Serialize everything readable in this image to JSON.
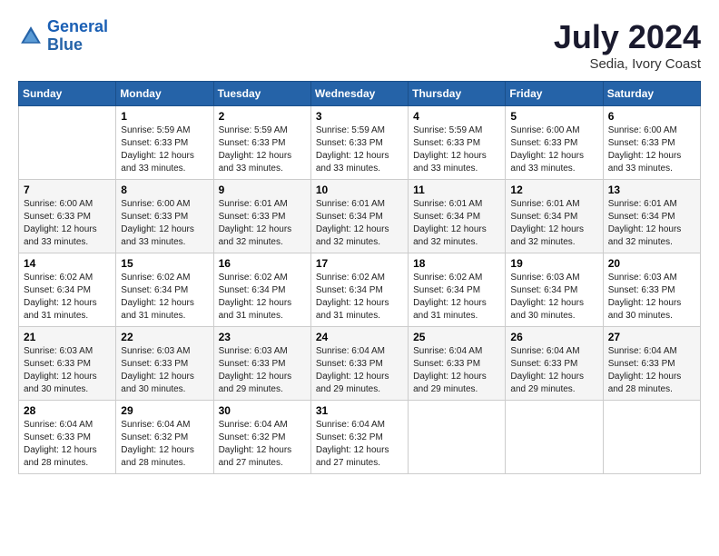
{
  "header": {
    "logo_line1": "General",
    "logo_line2": "Blue",
    "month_title": "July 2024",
    "location": "Sedia, Ivory Coast"
  },
  "weekdays": [
    "Sunday",
    "Monday",
    "Tuesday",
    "Wednesday",
    "Thursday",
    "Friday",
    "Saturday"
  ],
  "weeks": [
    [
      {
        "day": "",
        "info": ""
      },
      {
        "day": "1",
        "info": "Sunrise: 5:59 AM\nSunset: 6:33 PM\nDaylight: 12 hours\nand 33 minutes."
      },
      {
        "day": "2",
        "info": "Sunrise: 5:59 AM\nSunset: 6:33 PM\nDaylight: 12 hours\nand 33 minutes."
      },
      {
        "day": "3",
        "info": "Sunrise: 5:59 AM\nSunset: 6:33 PM\nDaylight: 12 hours\nand 33 minutes."
      },
      {
        "day": "4",
        "info": "Sunrise: 5:59 AM\nSunset: 6:33 PM\nDaylight: 12 hours\nand 33 minutes."
      },
      {
        "day": "5",
        "info": "Sunrise: 6:00 AM\nSunset: 6:33 PM\nDaylight: 12 hours\nand 33 minutes."
      },
      {
        "day": "6",
        "info": "Sunrise: 6:00 AM\nSunset: 6:33 PM\nDaylight: 12 hours\nand 33 minutes."
      }
    ],
    [
      {
        "day": "7",
        "info": "Sunrise: 6:00 AM\nSunset: 6:33 PM\nDaylight: 12 hours\nand 33 minutes."
      },
      {
        "day": "8",
        "info": "Sunrise: 6:00 AM\nSunset: 6:33 PM\nDaylight: 12 hours\nand 33 minutes."
      },
      {
        "day": "9",
        "info": "Sunrise: 6:01 AM\nSunset: 6:33 PM\nDaylight: 12 hours\nand 32 minutes."
      },
      {
        "day": "10",
        "info": "Sunrise: 6:01 AM\nSunset: 6:34 PM\nDaylight: 12 hours\nand 32 minutes."
      },
      {
        "day": "11",
        "info": "Sunrise: 6:01 AM\nSunset: 6:34 PM\nDaylight: 12 hours\nand 32 minutes."
      },
      {
        "day": "12",
        "info": "Sunrise: 6:01 AM\nSunset: 6:34 PM\nDaylight: 12 hours\nand 32 minutes."
      },
      {
        "day": "13",
        "info": "Sunrise: 6:01 AM\nSunset: 6:34 PM\nDaylight: 12 hours\nand 32 minutes."
      }
    ],
    [
      {
        "day": "14",
        "info": "Sunrise: 6:02 AM\nSunset: 6:34 PM\nDaylight: 12 hours\nand 31 minutes."
      },
      {
        "day": "15",
        "info": "Sunrise: 6:02 AM\nSunset: 6:34 PM\nDaylight: 12 hours\nand 31 minutes."
      },
      {
        "day": "16",
        "info": "Sunrise: 6:02 AM\nSunset: 6:34 PM\nDaylight: 12 hours\nand 31 minutes."
      },
      {
        "day": "17",
        "info": "Sunrise: 6:02 AM\nSunset: 6:34 PM\nDaylight: 12 hours\nand 31 minutes."
      },
      {
        "day": "18",
        "info": "Sunrise: 6:02 AM\nSunset: 6:34 PM\nDaylight: 12 hours\nand 31 minutes."
      },
      {
        "day": "19",
        "info": "Sunrise: 6:03 AM\nSunset: 6:34 PM\nDaylight: 12 hours\nand 30 minutes."
      },
      {
        "day": "20",
        "info": "Sunrise: 6:03 AM\nSunset: 6:33 PM\nDaylight: 12 hours\nand 30 minutes."
      }
    ],
    [
      {
        "day": "21",
        "info": "Sunrise: 6:03 AM\nSunset: 6:33 PM\nDaylight: 12 hours\nand 30 minutes."
      },
      {
        "day": "22",
        "info": "Sunrise: 6:03 AM\nSunset: 6:33 PM\nDaylight: 12 hours\nand 30 minutes."
      },
      {
        "day": "23",
        "info": "Sunrise: 6:03 AM\nSunset: 6:33 PM\nDaylight: 12 hours\nand 29 minutes."
      },
      {
        "day": "24",
        "info": "Sunrise: 6:04 AM\nSunset: 6:33 PM\nDaylight: 12 hours\nand 29 minutes."
      },
      {
        "day": "25",
        "info": "Sunrise: 6:04 AM\nSunset: 6:33 PM\nDaylight: 12 hours\nand 29 minutes."
      },
      {
        "day": "26",
        "info": "Sunrise: 6:04 AM\nSunset: 6:33 PM\nDaylight: 12 hours\nand 29 minutes."
      },
      {
        "day": "27",
        "info": "Sunrise: 6:04 AM\nSunset: 6:33 PM\nDaylight: 12 hours\nand 28 minutes."
      }
    ],
    [
      {
        "day": "28",
        "info": "Sunrise: 6:04 AM\nSunset: 6:33 PM\nDaylight: 12 hours\nand 28 minutes."
      },
      {
        "day": "29",
        "info": "Sunrise: 6:04 AM\nSunset: 6:32 PM\nDaylight: 12 hours\nand 28 minutes."
      },
      {
        "day": "30",
        "info": "Sunrise: 6:04 AM\nSunset: 6:32 PM\nDaylight: 12 hours\nand 27 minutes."
      },
      {
        "day": "31",
        "info": "Sunrise: 6:04 AM\nSunset: 6:32 PM\nDaylight: 12 hours\nand 27 minutes."
      },
      {
        "day": "",
        "info": ""
      },
      {
        "day": "",
        "info": ""
      },
      {
        "day": "",
        "info": ""
      }
    ]
  ]
}
